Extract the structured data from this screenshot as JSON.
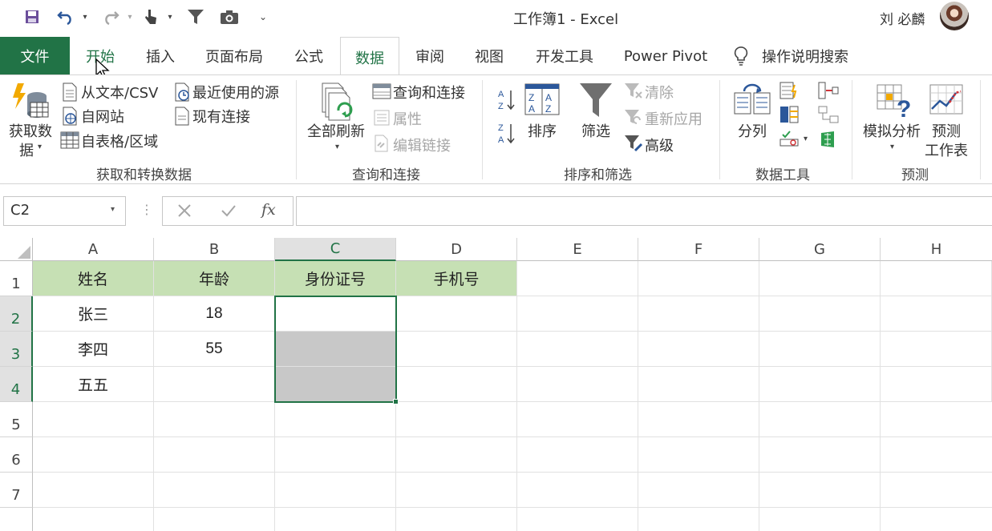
{
  "window": {
    "title": "工作簿1  -  Excel",
    "user": "刘 必麟"
  },
  "tabs": [
    "文件",
    "开始",
    "插入",
    "页面布局",
    "公式",
    "数据",
    "审阅",
    "视图",
    "开发工具",
    "Power Pivot",
    "操作说明搜索"
  ],
  "ribbon": {
    "group1": {
      "get_data": "获取数",
      "get_data2": "据",
      "from_text": "从文本/CSV",
      "from_web": "自网站",
      "from_table": "自表格/区域",
      "recent": "最近使用的源",
      "existing": "现有连接",
      "label": "获取和转换数据"
    },
    "group2": {
      "refresh_all": "全部刷新",
      "queries": "查询和连接",
      "properties": "属性",
      "edit_links": "编辑链接",
      "label": "查询和连接"
    },
    "group3": {
      "sort": "排序",
      "filter": "筛选",
      "clear": "清除",
      "reapply": "重新应用",
      "advanced": "高级",
      "label": "排序和筛选"
    },
    "group4": {
      "split": "分列",
      "label": "数据工具"
    },
    "group5": {
      "whatif": "模拟分析",
      "forecast": "预测",
      "forecast2": "工作表",
      "label": "预测"
    }
  },
  "formula_bar": {
    "name_box": "C2",
    "formula": ""
  },
  "columns": [
    "A",
    "B",
    "C",
    "D",
    "E",
    "F",
    "G",
    "H"
  ],
  "rows": [
    "1",
    "2",
    "3",
    "4",
    "5",
    "6",
    "7"
  ],
  "cells": {
    "A1": "姓名",
    "B1": "年龄",
    "C1": "身份证号",
    "D1": "手机号",
    "A2": "张三",
    "B2": "18",
    "A3": "李四",
    "B3": "55",
    "A4": "五五"
  },
  "colors": {
    "accent": "#217346",
    "header_fill": "#C6E0B4",
    "selection_fill": "#C8C8C8"
  }
}
